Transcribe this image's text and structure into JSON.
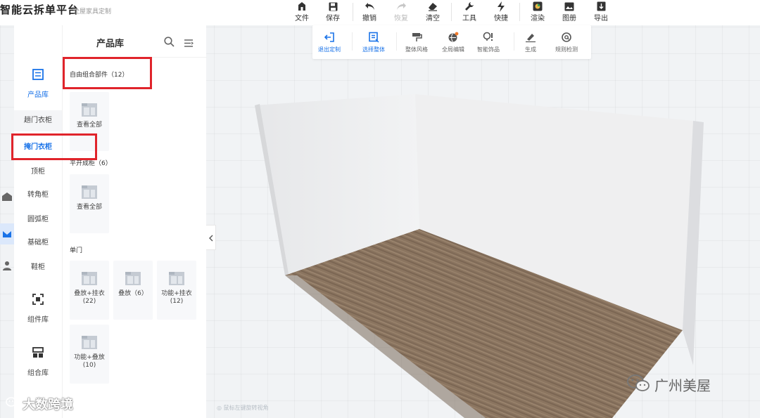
{
  "app": {
    "title": "智能云拆单平台",
    "subtitle": "全屋家具定制"
  },
  "toolbar": {
    "items": [
      {
        "label": "文件",
        "icon": "home-file-icon"
      },
      {
        "label": "保存",
        "icon": "save-icon"
      },
      {
        "label": "撤销",
        "icon": "undo-icon"
      },
      {
        "label": "恢复",
        "icon": "redo-icon",
        "disabled": true
      },
      {
        "label": "清空",
        "icon": "eraser-icon"
      },
      {
        "label": "工具",
        "icon": "wrench-icon"
      },
      {
        "label": "快捷",
        "icon": "lightning-icon"
      },
      {
        "label": "渲染",
        "icon": "render-icon"
      },
      {
        "label": "图册",
        "icon": "album-icon"
      },
      {
        "label": "导出",
        "icon": "export-icon"
      }
    ]
  },
  "subtoolbar": {
    "items": [
      {
        "label": "退出定制",
        "icon": "exit-icon",
        "active": true
      },
      {
        "label": "选择整体",
        "icon": "select-all-icon",
        "active": true
      },
      {
        "label": "整体风格",
        "icon": "style-brush-icon"
      },
      {
        "label": "全局编辑",
        "icon": "global-edit-icon"
      },
      {
        "label": "智能饰品",
        "icon": "smart-decor-icon"
      },
      {
        "label": "生成",
        "icon": "generate-icon"
      },
      {
        "label": "规则检测",
        "icon": "rule-check-icon"
      }
    ]
  },
  "rail": {
    "main": [
      {
        "label": "产品库",
        "icon": "product-library-icon",
        "active": true
      },
      {
        "label": "组件库",
        "icon": "component-library-icon"
      },
      {
        "label": "组合库",
        "icon": "combo-library-icon"
      }
    ],
    "sub": [
      {
        "label": "趟门衣柜"
      },
      {
        "label": "掩门衣柜",
        "selected": true
      },
      {
        "label": "顶柜"
      },
      {
        "label": "转角柜"
      },
      {
        "label": "圆弧柜"
      },
      {
        "label": "基础柜"
      },
      {
        "label": "鞋柜"
      }
    ]
  },
  "panel": {
    "title": "产品库",
    "sections": [
      {
        "title": "自由组合部件（12）",
        "cards": [
          {
            "label": "查看全部"
          }
        ]
      },
      {
        "title": "平开成柜（6）",
        "cards": [
          {
            "label": "查看全部"
          }
        ]
      },
      {
        "title": "单门",
        "cards": [
          {
            "label": "叠放+挂衣\n(22)"
          },
          {
            "label": "叠放（6）"
          },
          {
            "label": "功能+挂衣\n(12)"
          },
          {
            "label": "功能+叠放\n(10)"
          }
        ]
      }
    ]
  },
  "viewport": {
    "tip": "◎ 鼠标左键旋转视角"
  },
  "watermarks": {
    "left": "大数跨境",
    "right": "广州美屋"
  },
  "colors": {
    "accent": "#1a73e8",
    "highlight_box": "#e0242b",
    "floor": "#8a7460",
    "wall": "#e9eaec"
  }
}
